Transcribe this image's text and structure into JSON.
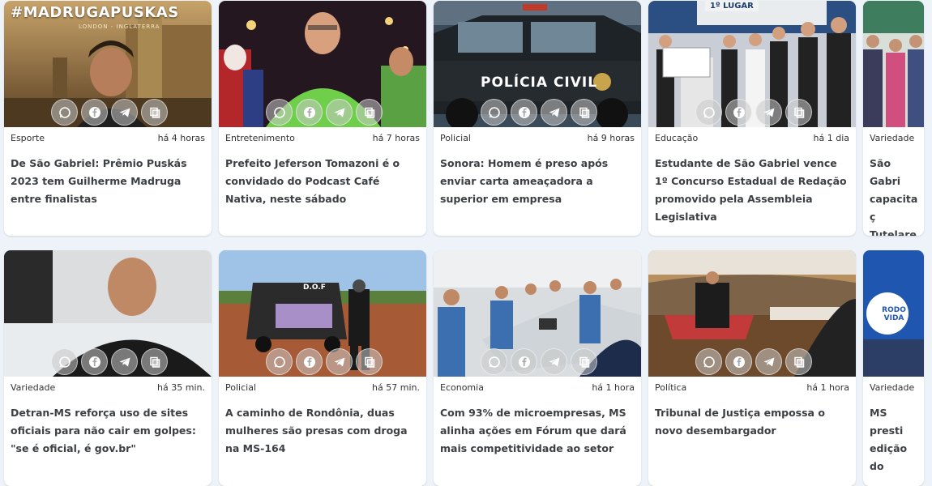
{
  "cards": [
    {
      "category": "Esporte",
      "time": "há 4 horas",
      "title": "De São Gabriel: Prêmio Puskás 2023 tem Guilherme Madruga entre finalistas",
      "overlay": "#MADRUGAPUSKAS",
      "overlay_sub": "LONDON - INGLATERRA"
    },
    {
      "category": "Entretenimento",
      "time": "há 7 horas",
      "title": "Prefeito Jeferson Tomazoni é o convidado do Podcast Café Nativa, neste sábado"
    },
    {
      "category": "Policial",
      "time": "há 9 horas",
      "title": "Sonora: Homem é preso após enviar carta ameaçadora a superior em empresa",
      "overlay": "POLÍCIA CIVIL"
    },
    {
      "category": "Educação",
      "time": "há 1 dia",
      "title": "Estudante de São Gabriel vence 1º Concurso Estadual de Redação promovido pela Assembleia Legislativa",
      "overlay": "1º LUGAR"
    },
    {
      "category": "Variedade",
      "time": "",
      "title": "São Gabri capacitaç Tutelares"
    },
    {
      "category": "Variedade",
      "time": "há 35 min.",
      "title": "Detran-MS reforça uso de sites oficiais para não cair em golpes: \"se é oficial, é gov.br\""
    },
    {
      "category": "Policial",
      "time": "há 57 min.",
      "title": "A caminho de Rondônia, duas mulheres são presas com droga na MS-164",
      "overlay": "D.O.F"
    },
    {
      "category": "Economia",
      "time": "há 1 hora",
      "title": "Com 93% de microempresas, MS alinha ações em Fórum que dará mais competitividade ao setor"
    },
    {
      "category": "Política",
      "time": "há 1 hora",
      "title": "Tribunal de Justiça empossa o novo desembargador"
    },
    {
      "category": "Variedade",
      "time": "",
      "title": "MS presti edição do",
      "overlay": "RODO VIDA"
    }
  ],
  "colors": {
    "background": "#eef3f9",
    "card": "#ffffff",
    "title_text": "#3c3f44",
    "meta_text": "#333333"
  },
  "share_icons": [
    "whatsapp-icon",
    "facebook-icon",
    "telegram-icon",
    "copy-link-icon"
  ]
}
